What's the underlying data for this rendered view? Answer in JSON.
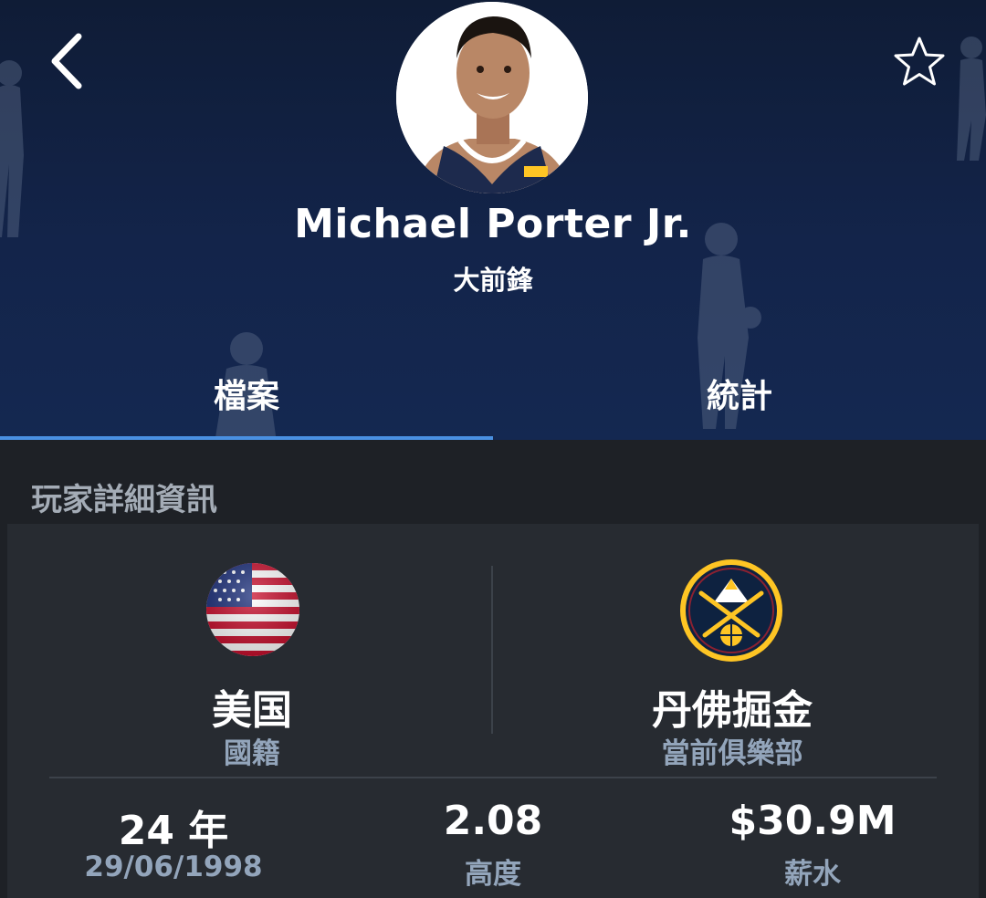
{
  "header": {
    "player_name": "Michael Porter Jr.",
    "position": "大前鋒",
    "back_icon": "chevron-left-icon",
    "favorite_icon": "star-outline-icon"
  },
  "tabs": [
    {
      "label": "檔案",
      "active": true
    },
    {
      "label": "統計",
      "active": false
    }
  ],
  "details": {
    "section_title": "玩家詳細資訊",
    "nationality": {
      "value": "美国",
      "label": "國籍",
      "icon": "usa-flag-icon"
    },
    "club": {
      "value": "丹佛掘金",
      "label": "當前俱樂部",
      "icon": "denver-nuggets-logo"
    },
    "age": {
      "value": "24 年",
      "label": "29/06/1998"
    },
    "height": {
      "value": "2.08",
      "label": "高度"
    },
    "salary": {
      "value": "$30.9M",
      "label": "薪水"
    }
  },
  "colors": {
    "header_bg": "#13244a",
    "tab_indicator": "#4a90e2",
    "card_bg": "#272b31",
    "label_color": "#93a5bb"
  }
}
